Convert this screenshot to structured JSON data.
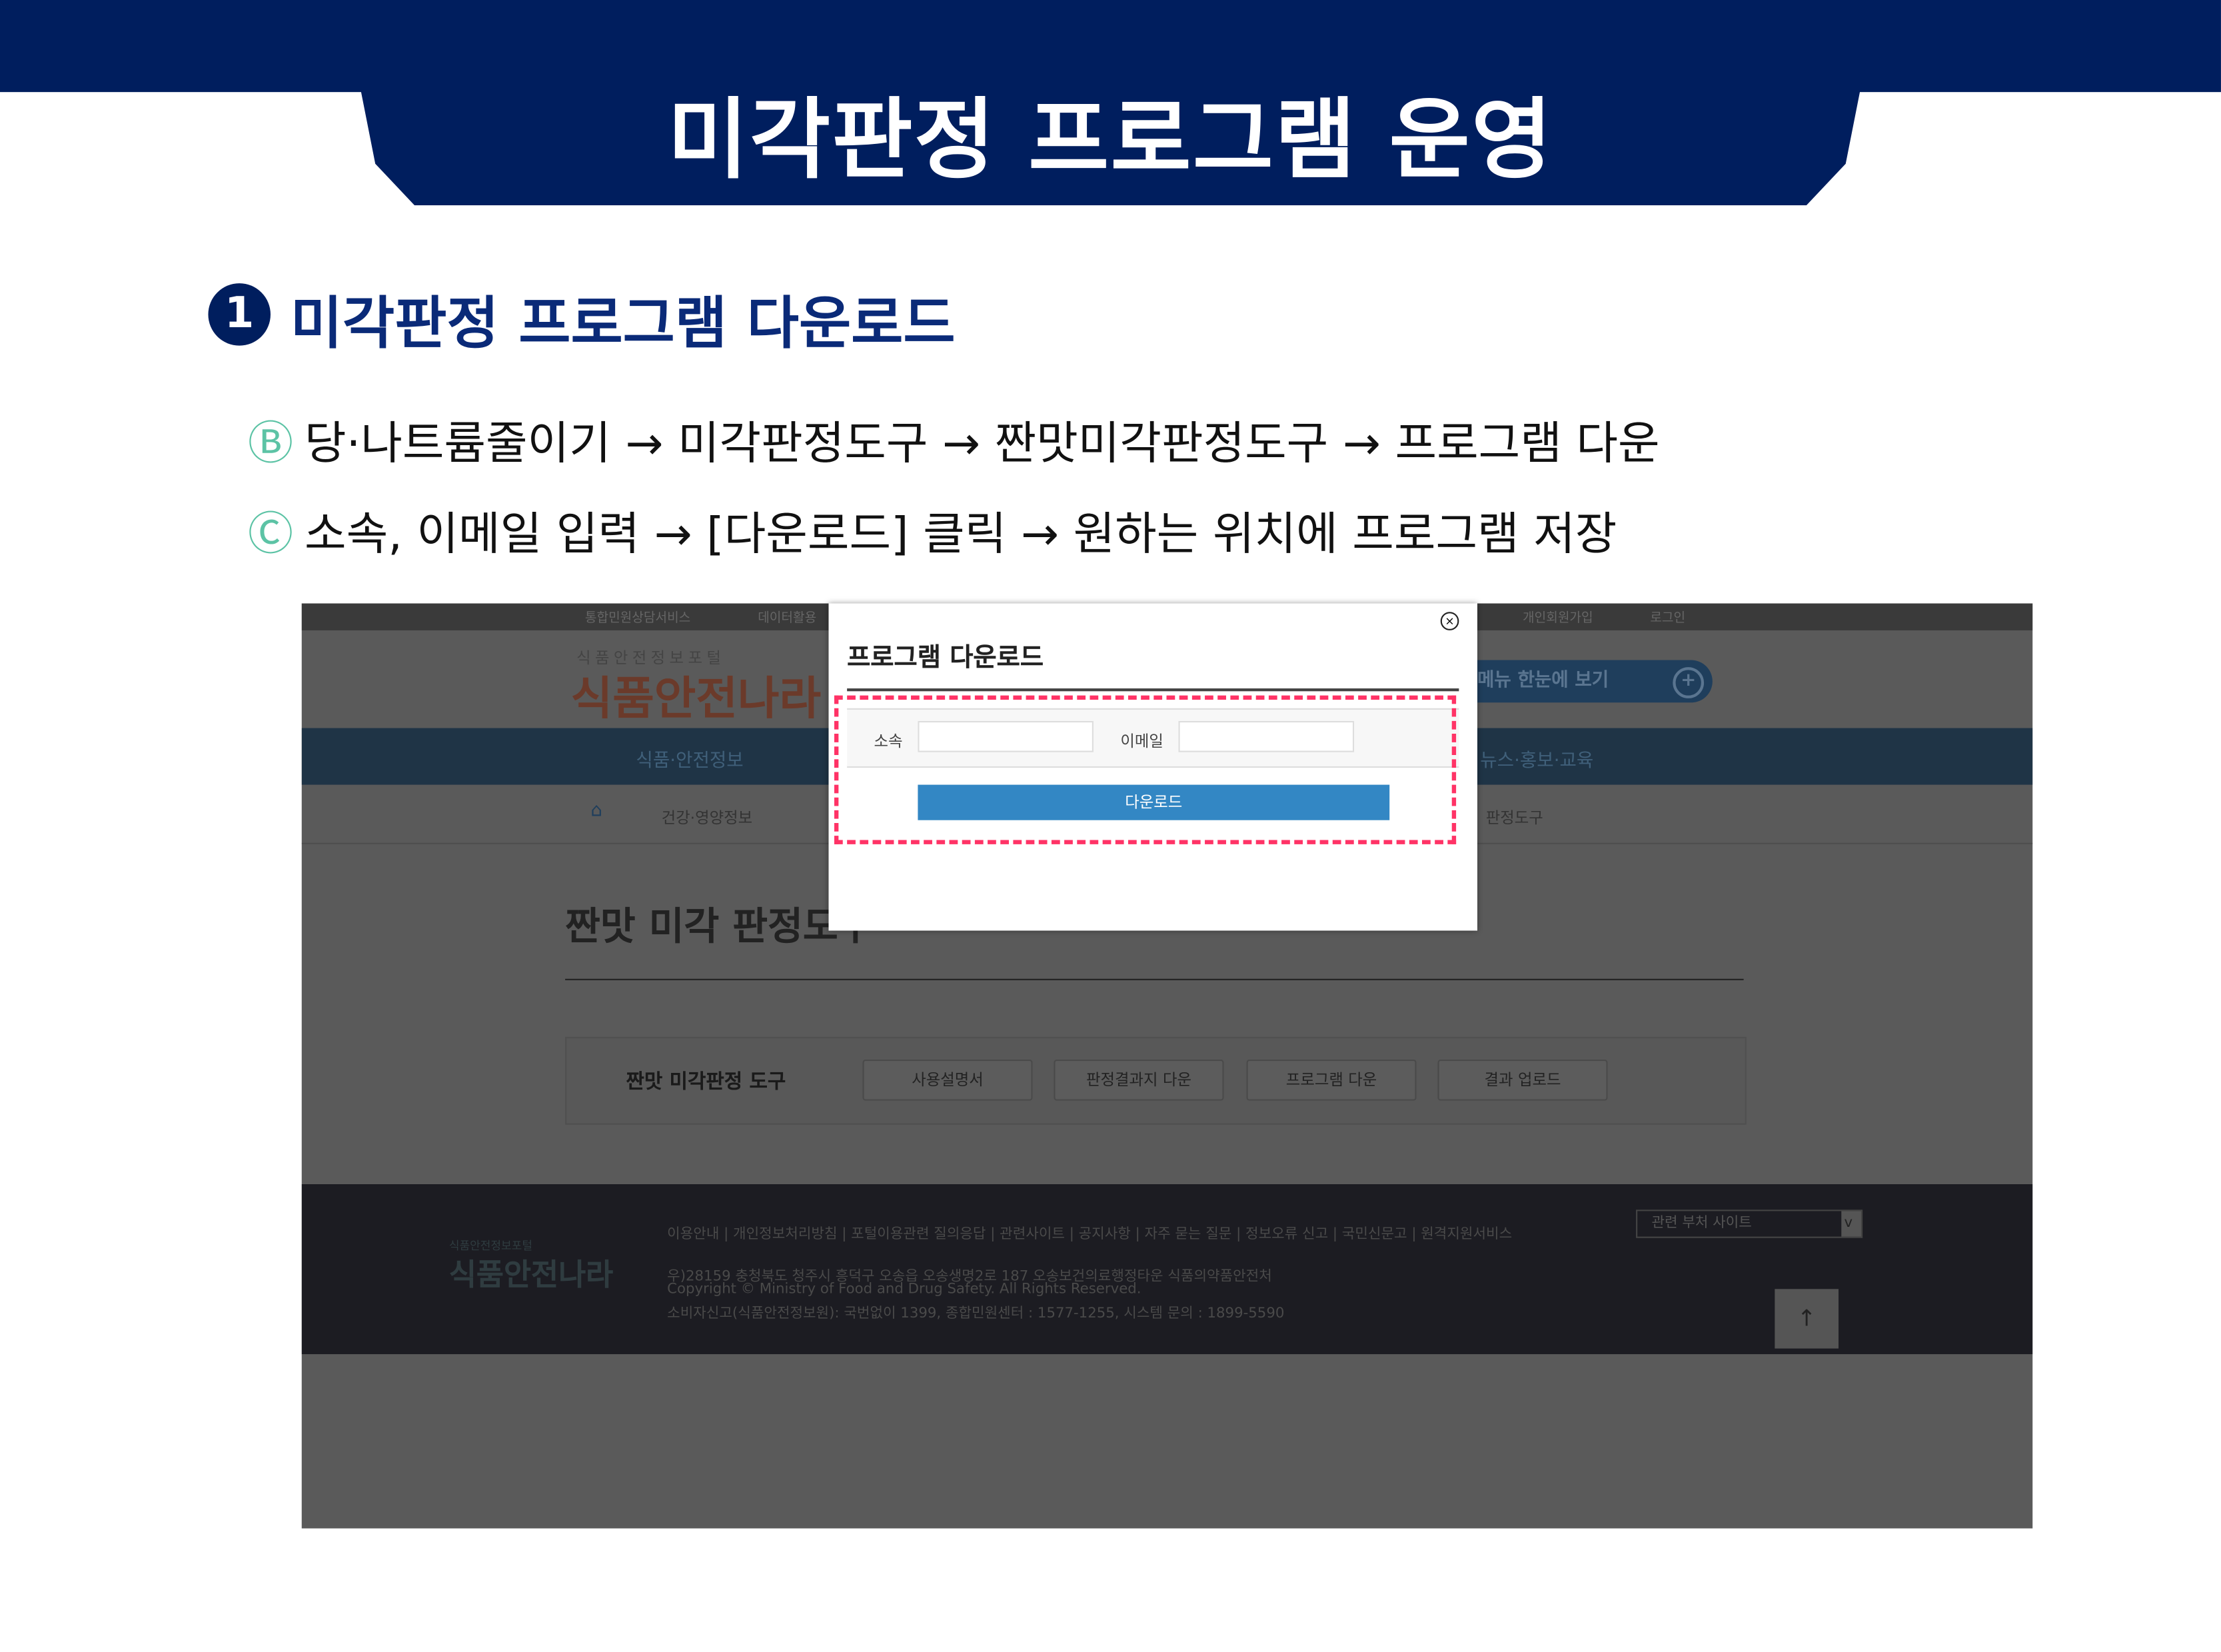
{
  "slide": {
    "title": "미각판정 프로그램 운영",
    "section_number": "1",
    "section_title": "미각판정 프로그램 다운로드",
    "steps": [
      {
        "marker": "Ⓑ",
        "text": "당·나트륨줄이기 → 미각판정도구 → 짠맛미각판정도구 → 프로그램 다운"
      },
      {
        "marker": "Ⓒ",
        "text": "소속, 이메일 입력 → [다운로드] 클릭 → 원하는 위치에 프로그램 저장"
      }
    ],
    "accent": "#001e5e",
    "highlight": "#ff3366"
  },
  "site": {
    "util_links": [
      "통합민원상담서비스",
      "데이터활용",
      "개인회원가입",
      "로그인"
    ],
    "logo_small": "식품안전정보포털",
    "logo": "식품안전나라",
    "menu_button": "메뉴 한눈에 보기",
    "nav": [
      "식품·안전정보",
      "뉴스·홍보·교육"
    ],
    "breadcrumb": [
      "건강·영양정보",
      "판정도구"
    ],
    "page_title": "짠맛 미각 판정도구",
    "tool_label": "짠맛 미각판정 도구",
    "tool_buttons": [
      "사용설명서",
      "판정결과지 다운",
      "프로그램 다운",
      "결과 업로드"
    ],
    "footer_links": "이용안내 | 개인정보처리방침 | 포털이용관련 질의응답 | 관련사이트 | 공지사항 | 자주 묻는 질문 | 정보오류 신고 | 국민신문고 | 원격지원서비스",
    "footer_select": "관련 부처 사이트",
    "footer_address": "우)28159 충청북도 청주시 흥덕구 오송읍 오송생명2로 187 오송보건의료행정타운 식품의약품안전처",
    "footer_copyright": "Copyright © Ministry of Food and Drug Safety. All Rights Reserved.",
    "footer_contact": "소비자신고(식품안전정보원): 국번없이 1399, 종합민원센터 : 1577-1255, 시스템 문의 : 1899-5590",
    "top_button": "↑"
  },
  "modal": {
    "title": "프로그램 다운로드",
    "affiliation_label": "소속",
    "affiliation_value": "",
    "email_label": "이메일",
    "email_value": "",
    "download_button": "다운로드",
    "close_icon": "circle-x"
  }
}
